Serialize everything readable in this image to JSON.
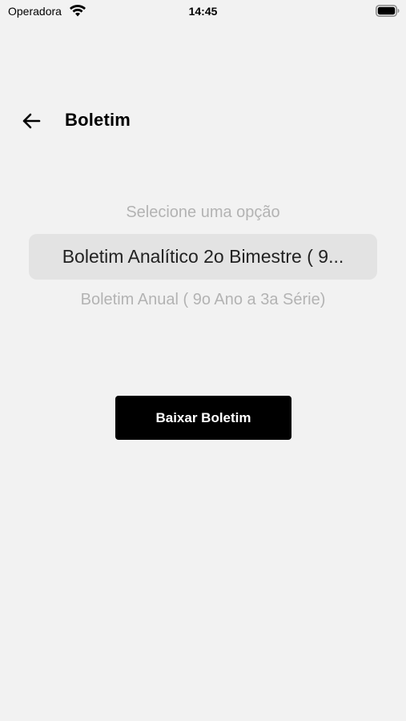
{
  "status_bar": {
    "carrier": "Operadora",
    "time": "14:45",
    "wifi_icon": "wifi-icon",
    "battery_icon": "battery-full-icon"
  },
  "header": {
    "back_icon": "arrow-left-icon",
    "title": "Boletim"
  },
  "picker": {
    "options": [
      "Selecione uma opção",
      "Boletim Analítico 2o Bimestre ( 9...",
      "Boletim Anual ( 9o Ano a 3a Série)"
    ],
    "selected_index": 1
  },
  "actions": {
    "download_label": "Baixar Boletim"
  },
  "colors": {
    "background": "#f2f2f2",
    "selected_row": "#e3e3e3",
    "button": "#000000",
    "muted_text": "#b3b3b3"
  }
}
